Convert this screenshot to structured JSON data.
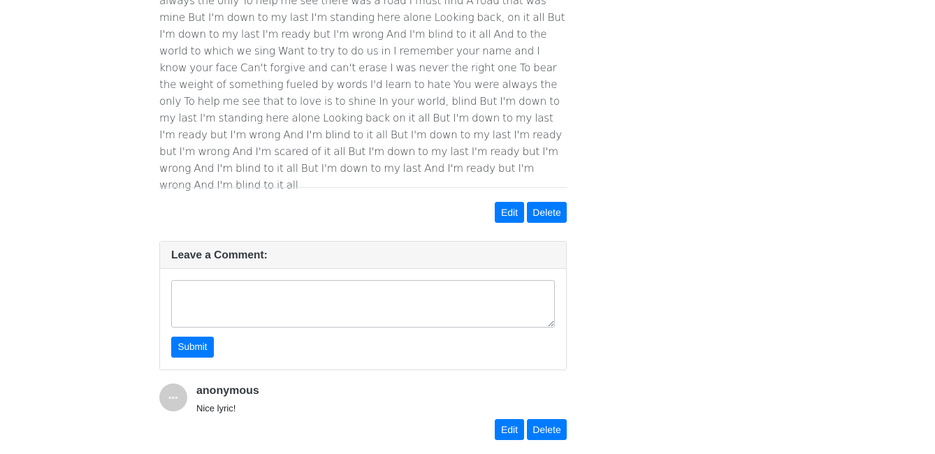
{
  "post": {
    "lyrics_text": "always the only To help me see there was a road I must find A road that was mine But I'm down to my last I'm standing here alone Looking back, on it all But I'm down to my last I'm ready but I'm wrong And I'm blind to it all And to the world to which we sing Want to try to do us in I remember your name and I know your face Can't forgive and can't erase I was never the right one To bear the weight of something fueled by words I'd learn to hate You were always the only To help me see that to love is to shine In your world, blind But I'm down to my last I'm standing here alone Looking back on it all But I'm down to my last I'm ready but I'm wrong And I'm blind to it all But I'm down to my last I'm ready but I'm wrong And I'm scared of it all But I'm down to my last I'm ready but I'm wrong And I'm blind to it all But I'm down to my last And I'm ready but I'm wrong And I'm blind to it all",
    "edit_label": "Edit",
    "delete_label": "Delete"
  },
  "comment_form": {
    "header": "Leave a Comment:",
    "textarea_value": "",
    "textarea_placeholder": "",
    "submit_label": "Submit"
  },
  "comments": [
    {
      "author": "anonymous",
      "avatar_icon": "user-avatar-icon",
      "text": "Nice lyric!",
      "edit_label": "Edit",
      "delete_label": "Delete"
    }
  ],
  "colors": {
    "primary_button": "#007bff",
    "card_header_bg": "#f6f6f6",
    "avatar_bg": "#cdcdcd"
  }
}
